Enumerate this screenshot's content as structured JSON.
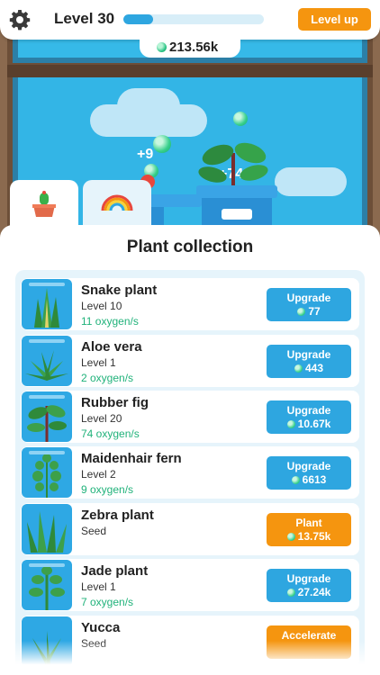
{
  "header": {
    "level_label": "Level 30",
    "xp_progress": 0.21,
    "level_up_label": "Level up",
    "oxygen_total": "213.56k"
  },
  "scene": {
    "popup_left": "+9",
    "popup_right": "+74"
  },
  "tabs": [
    {
      "icon": "cactus-pot-icon",
      "active": true
    },
    {
      "icon": "rainbow-icon",
      "active": false
    }
  ],
  "collection": {
    "title": "Plant collection",
    "plants": [
      {
        "name": "Snake plant",
        "level": "Level 10",
        "rate": "11 oxygen/s",
        "action": "Upgrade",
        "cost": "77",
        "action_color": "#2ea6e0"
      },
      {
        "name": "Aloe vera",
        "level": "Level 1",
        "rate": "2 oxygen/s",
        "action": "Upgrade",
        "cost": "443",
        "action_color": "#2ea6e0"
      },
      {
        "name": "Rubber fig",
        "level": "Level 20",
        "rate": "74 oxygen/s",
        "action": "Upgrade",
        "cost": "10.67k",
        "action_color": "#2ea6e0"
      },
      {
        "name": "Maidenhair fern",
        "level": "Level 2",
        "rate": "9 oxygen/s",
        "action": "Upgrade",
        "cost": "6613",
        "action_color": "#2ea6e0"
      },
      {
        "name": "Zebra plant",
        "level": "Seed",
        "rate": "",
        "action": "Plant",
        "cost": "13.75k",
        "action_color": "#f5950f"
      },
      {
        "name": "Jade plant",
        "level": "Level 1",
        "rate": "7 oxygen/s",
        "action": "Upgrade",
        "cost": "27.24k",
        "action_color": "#2ea6e0"
      },
      {
        "name": "Yucca",
        "level": "Seed",
        "rate": "",
        "action": "Accelerate",
        "cost": "",
        "action_color": "#f5950f"
      }
    ]
  },
  "colors": {
    "accent_blue": "#2ea6e0",
    "accent_orange": "#f5950f",
    "rate_green": "#20b27a"
  }
}
